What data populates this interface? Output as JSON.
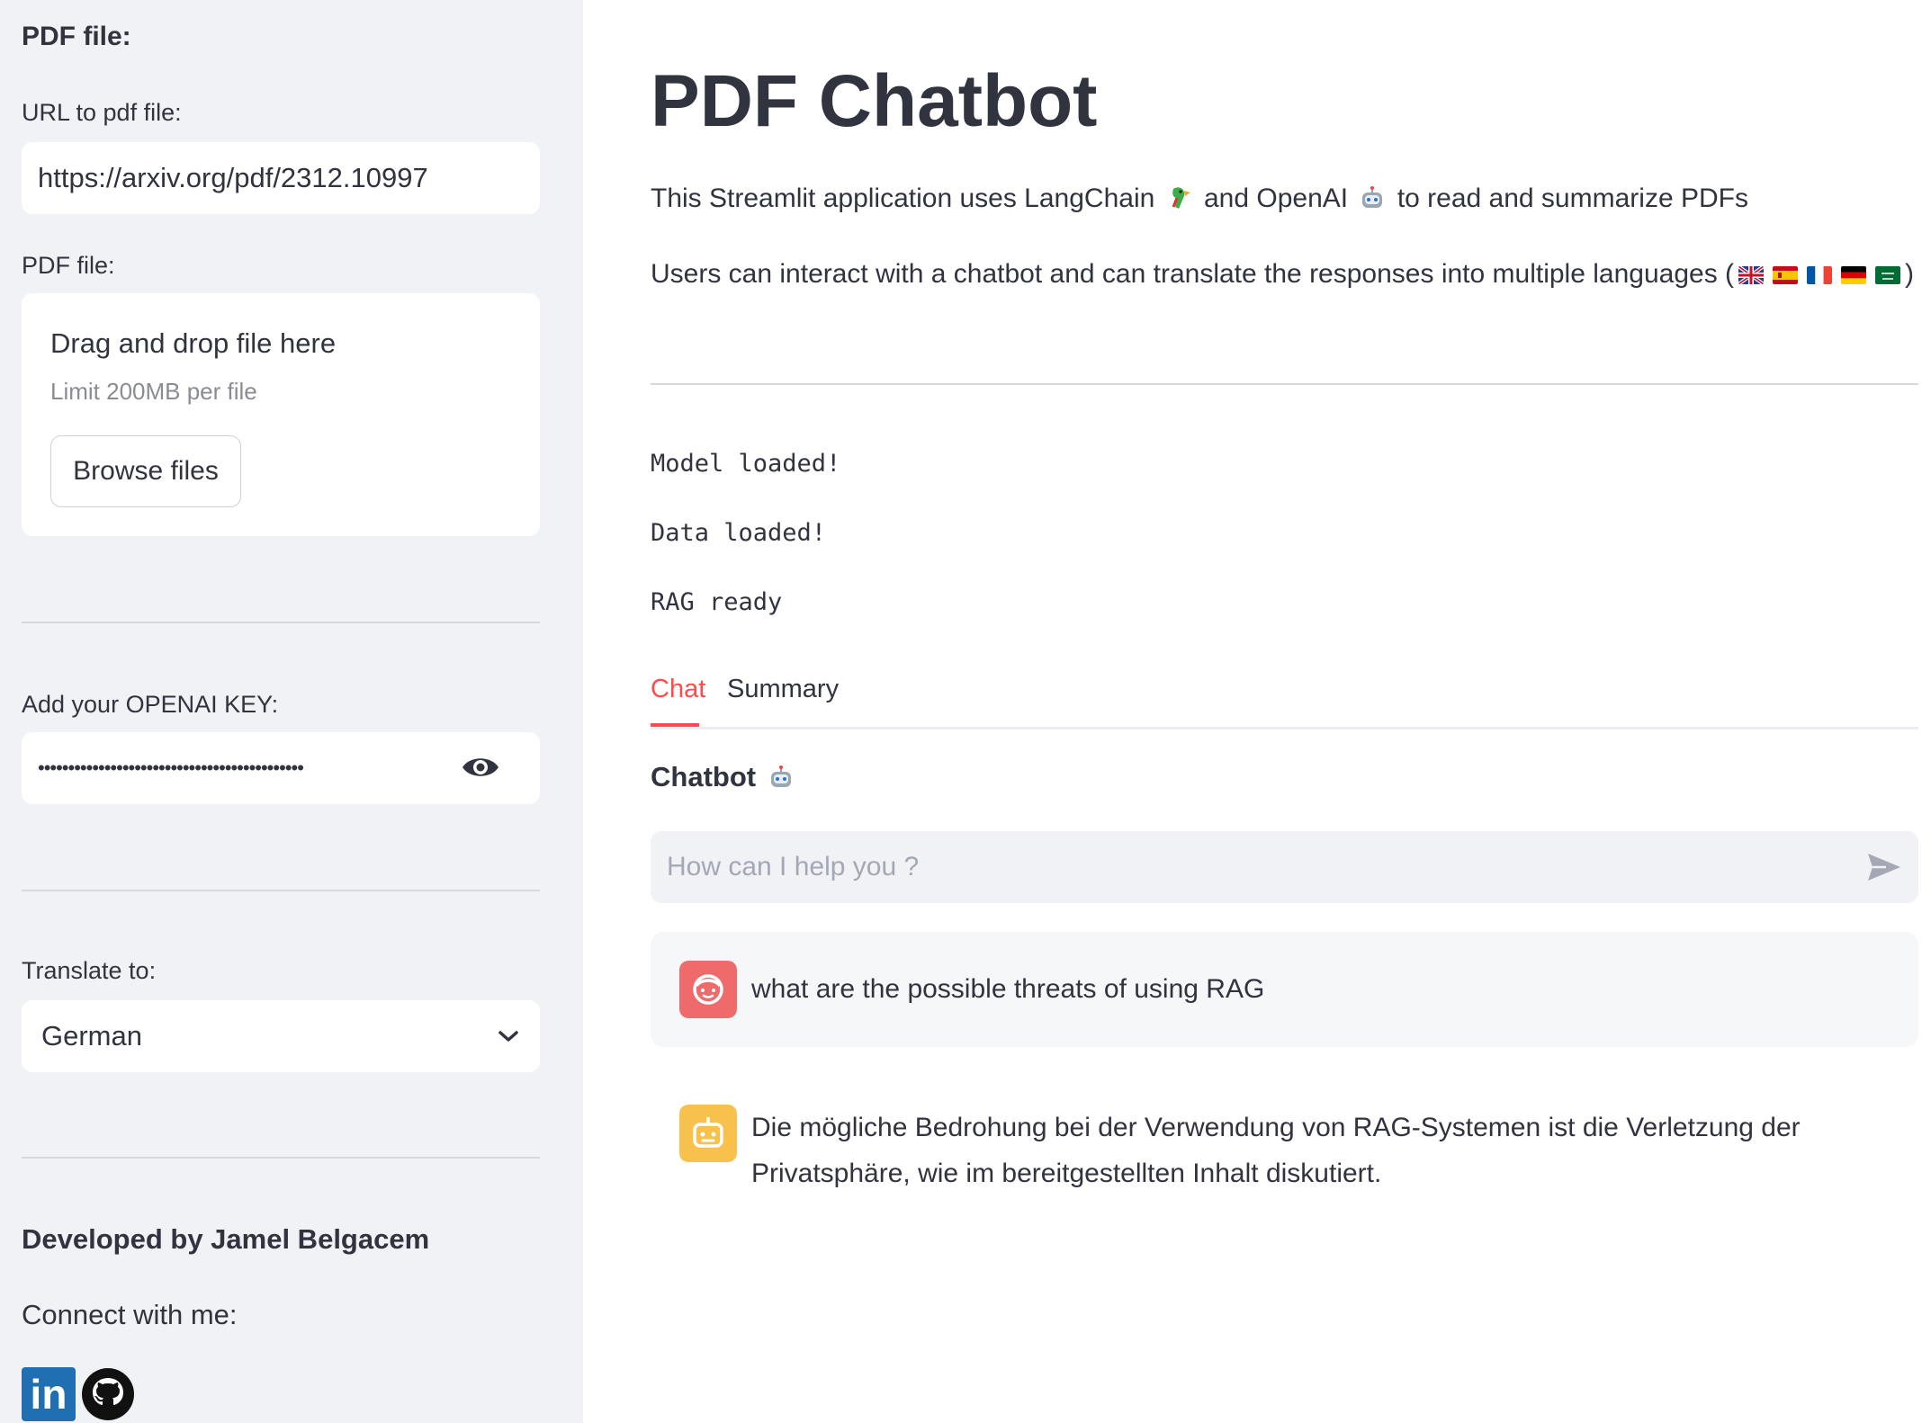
{
  "sidebar": {
    "section_title": "PDF file:",
    "url_label": "URL to pdf file:",
    "url_value": "https://arxiv.org/pdf/2312.10997",
    "file_label": "PDF file:",
    "uploader_title": "Drag and drop file here",
    "uploader_limit": "Limit 200MB per file",
    "browse_label": "Browse files",
    "key_label": "Add your OPENAI KEY:",
    "key_value": "••••••••••••••••••••••••••••••••••••••••••••",
    "translate_label": "Translate to:",
    "translate_value": "German",
    "developer": "Developed by Jamel Belgacem",
    "connect": "Connect with me:",
    "linkedin_text": "in"
  },
  "main": {
    "title": "PDF Chatbot",
    "desc1_a": "This Streamlit application uses LangChain",
    "desc1_b": "and OpenAI",
    "desc1_c": "to read and summarize PDFs",
    "desc2_a": "Users can interact with a chatbot and can translate the responses into multiple languages (",
    "desc2_b": ")",
    "status": [
      "Model loaded!",
      "Data loaded!",
      "RAG ready"
    ],
    "tabs": [
      {
        "label": "Chat",
        "active": true
      },
      {
        "label": "Summary",
        "active": false
      }
    ],
    "chatbot_heading": "Chatbot",
    "chat_placeholder": "How can I help you ?",
    "messages": [
      {
        "role": "user",
        "text": "what are the possible threats of using RAG"
      },
      {
        "role": "assistant",
        "text_line1": "Die mögliche Bedrohung bei der Verwendung von RAG-Systemen ist die Verletzung der",
        "text_line2": "Privatsphäre, wie im bereitgestellten Inhalt diskutiert."
      }
    ]
  },
  "colors": {
    "accent": "#ff4b4b",
    "user_avatar": "#ef6b6b",
    "bot_avatar": "#f7c14b",
    "sidebar_bg": "#f0f2f6"
  },
  "icons": [
    "parrot-icon",
    "robot-icon",
    "eye-icon",
    "chevron-down-icon",
    "send-icon",
    "user-face-icon",
    "bot-face-icon",
    "linkedin-icon",
    "github-icon",
    "flag-uk-icon",
    "flag-es-icon",
    "flag-fr-icon",
    "flag-de-icon",
    "flag-sa-icon"
  ]
}
